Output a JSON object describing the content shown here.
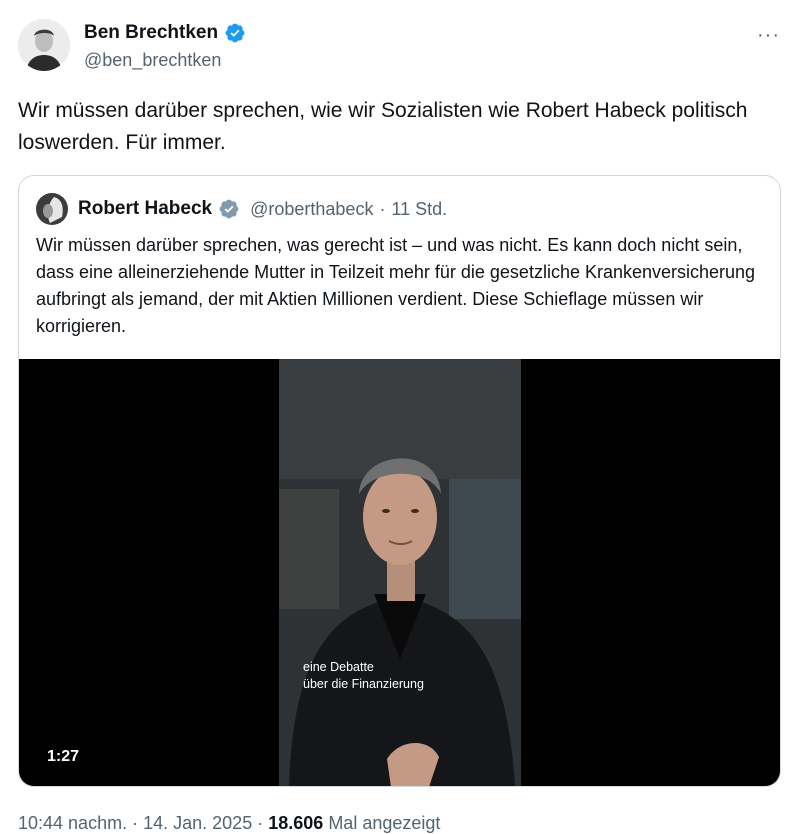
{
  "tweet": {
    "author_name": "Ben Brechtken",
    "author_handle": "@ben_brechtken",
    "more_label": "···",
    "text": "Wir müssen darüber sprechen, wie wir Sozialisten wie Robert Habeck politisch loswerden. Für immer.",
    "timestamp": "10:44 nachm.",
    "date": "14. Jan. 2025",
    "separator": "·",
    "views": "18.606",
    "views_label": "Mal angezeigt"
  },
  "quoted": {
    "author_name": "Robert Habeck",
    "author_handle": "@roberthabeck",
    "separator": "·",
    "time": "11 Std.",
    "text": "Wir müssen darüber sprechen, was gerecht ist – und was nicht. Es kann doch nicht sein, dass eine alleinerziehende Mutter in Teilzeit mehr für die gesetzliche Krankenversicherung aufbringt als jemand, der mit Aktien Millionen verdient. Diese Schieflage müssen wir korrigieren.",
    "video": {
      "subtitle_line1": "eine Debatte",
      "subtitle_line2": "über die Finanzierung",
      "duration": "1:27"
    }
  },
  "colors": {
    "verified_blue": "#1d9bf0",
    "verified_gray": "#829aab",
    "secondary_text": "#536471",
    "border": "#cfd9de"
  },
  "icons": [
    "verified-badge-icon",
    "verified-gray-badge-icon",
    "more-options-icon"
  ]
}
